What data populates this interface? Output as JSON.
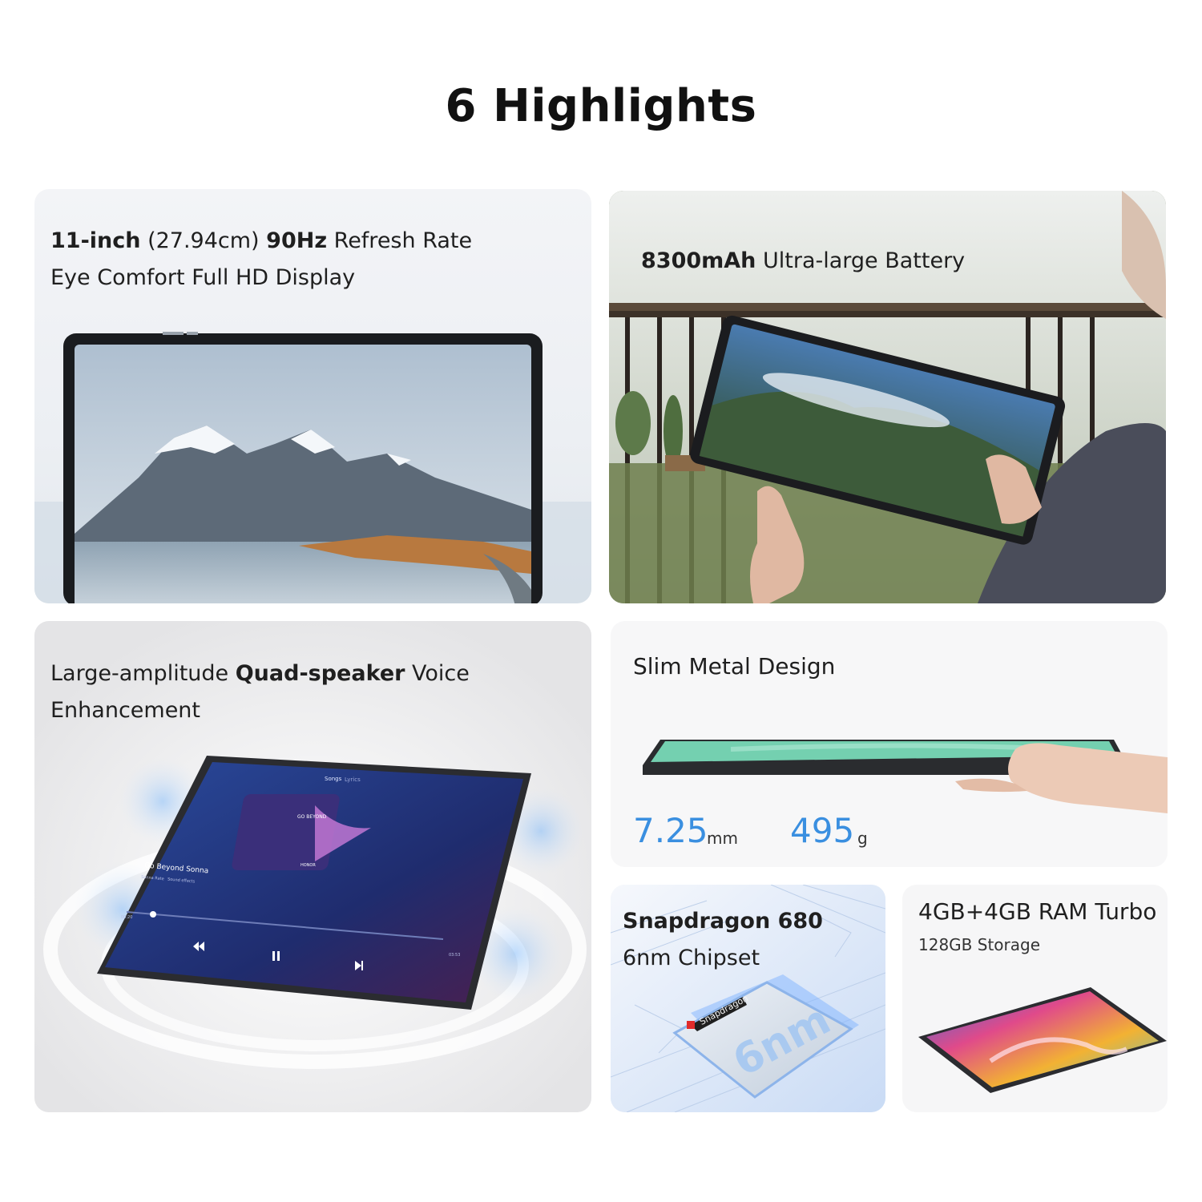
{
  "page": {
    "title": "6 Highlights"
  },
  "display_card": {
    "line1_bold_a": "11-inch",
    "line1_text_a": " (27.94cm) ",
    "line1_bold_b": "90Hz",
    "line1_text_b": " Refresh Rate",
    "line2": "Eye Comfort Full HD Display"
  },
  "battery_card": {
    "bold": "8300mAh",
    "text": " Ultra-large Battery"
  },
  "speaker_card": {
    "line1_text_a": "Large-amplitude ",
    "line1_bold": "Quad-speaker",
    "line1_text_b": " Voice",
    "line2": "Enhancement",
    "screen": {
      "tab_songs": "Songs",
      "tab_lyrics": "Lyrics",
      "album_title": "GO BEYOND",
      "album_brand": "HONOR",
      "track_name": "Go Beyond Sonna",
      "track_meta": "Sonna Rate",
      "track_chip": "Sound effects",
      "time_start": "00:20",
      "time_end": "03:53"
    }
  },
  "design_card": {
    "title": "Slim Metal Design",
    "thickness_value": "7.25",
    "thickness_unit": "mm",
    "weight_value": "495",
    "weight_unit": "g"
  },
  "chipset_card": {
    "line1": "Snapdragon 680",
    "line2": "6nm Chipset",
    "chip_brand": "Snapdragon",
    "chip_label": "6nm"
  },
  "memory_card": {
    "title": "4GB+4GB RAM Turbo",
    "subtitle": "128GB Storage"
  },
  "colors": {
    "accent_blue": "#3a8fe0",
    "title_text": "#111111",
    "body_text": "#1f1f1f"
  }
}
